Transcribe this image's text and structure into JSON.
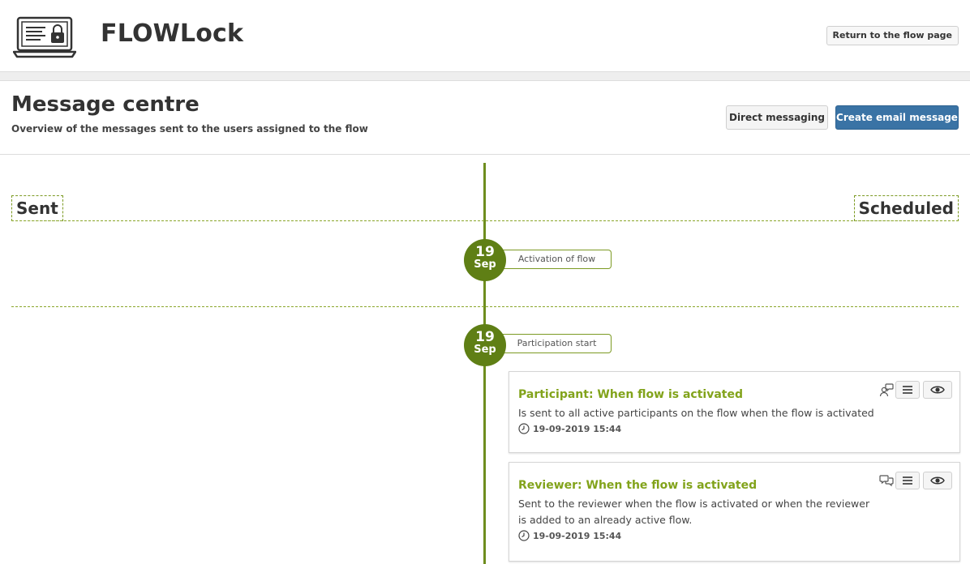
{
  "app": {
    "title": "FLOWLock",
    "return_button": "Return to the flow page"
  },
  "page": {
    "title": "Message centre",
    "subtitle": "Overview of the messages sent to the users assigned to the flow",
    "direct_messaging_button": "Direct messaging",
    "create_email_button": "Create email message"
  },
  "timeline": {
    "sent_label": "Sent",
    "scheduled_label": "Scheduled",
    "events": [
      {
        "day": "19",
        "month": "Sep",
        "label": "Activation of flow"
      },
      {
        "day": "19",
        "month": "Sep",
        "label": "Participation start"
      }
    ],
    "messages": [
      {
        "title": "Participant: When flow is activated",
        "description": "Is sent to all active participants on the flow when the flow is activated",
        "timestamp": "19-09-2019 15:44",
        "type_icon": "single-user-message-icon"
      },
      {
        "title": "Reviewer: When the flow is activated",
        "description": "Sent to the reviewer when the flow is activated or when the reviewer is added to an already active flow.",
        "timestamp": "19-09-2019 15:44",
        "type_icon": "conversation-icon"
      }
    ]
  },
  "colors": {
    "accent_green": "#5f7f15",
    "title_green": "#82a31b",
    "primary_blue": "#3a73a5"
  }
}
